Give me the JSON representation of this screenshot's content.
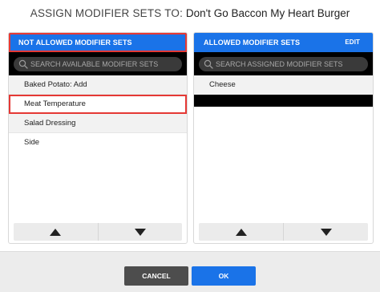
{
  "dialog": {
    "title_prefix": "ASSIGN MODIFIER SETS TO:",
    "item_name": "Don't Go Baccon My Heart Burger"
  },
  "not_allowed": {
    "header": "NOT ALLOWED MODIFIER SETS",
    "search_placeholder": "SEARCH AVAILABLE MODIFIER SETS",
    "items": [
      {
        "label": "Baked Potato: Add"
      },
      {
        "label": "Meat Temperature"
      },
      {
        "label": "Salad Dressing"
      },
      {
        "label": "Side"
      }
    ]
  },
  "allowed": {
    "header": "ALLOWED MODIFIER SETS",
    "edit_label": "EDIT",
    "search_placeholder": "SEARCH ASSIGNED MODIFIER SETS",
    "items": [
      {
        "label": "Cheese"
      }
    ]
  },
  "footer": {
    "cancel_label": "CANCEL",
    "ok_label": "OK"
  },
  "colors": {
    "accent": "#1a73e8",
    "highlight": "#e53935",
    "search_bar": "#000000",
    "cancel": "#4d4d4d"
  }
}
